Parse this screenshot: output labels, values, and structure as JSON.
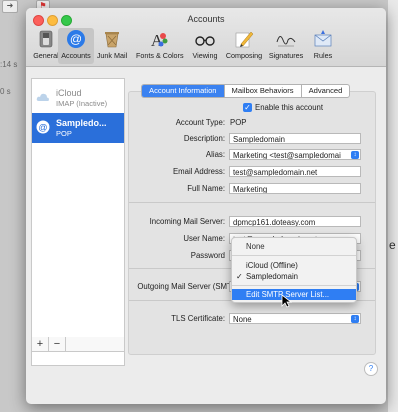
{
  "background": {
    "left_fragment_1": ":14 s",
    "left_fragment_2": "0 s",
    "right_fragment": "e"
  },
  "window": {
    "title": "Accounts"
  },
  "toolbar": {
    "items": [
      {
        "label": "General",
        "icon": "switch-icon"
      },
      {
        "label": "Accounts",
        "icon": "at-icon"
      },
      {
        "label": "Junk Mail",
        "icon": "trash-icon"
      },
      {
        "label": "Fonts & Colors",
        "icon": "font-palette-icon"
      },
      {
        "label": "Viewing",
        "icon": "glasses-icon"
      },
      {
        "label": "Composing",
        "icon": "pencil-icon"
      },
      {
        "label": "Signatures",
        "icon": "signature-icon"
      },
      {
        "label": "Rules",
        "icon": "envelope-icon"
      }
    ],
    "selected": "Accounts"
  },
  "accounts": {
    "items": [
      {
        "name": "iCloud",
        "sub": "IMAP (Inactive)",
        "icon": "cloud-icon"
      },
      {
        "name": "Sampledo...",
        "sub": "POP",
        "icon": "at-icon"
      }
    ],
    "add_label": "+",
    "remove_label": "−"
  },
  "tabs": {
    "items": [
      "Account Information",
      "Mailbox Behaviors",
      "Advanced"
    ],
    "active": "Account Information"
  },
  "form": {
    "enable_label": "Enable this account",
    "enabled": true,
    "account_type_label": "Account Type:",
    "account_type_value": "POP",
    "description_label": "Description:",
    "description_value": "Sampledomain",
    "alias_label": "Alias:",
    "alias_value": "Marketing <test@sampledomai",
    "email_label": "Email Address:",
    "email_value": "test@sampledomain.net",
    "fullname_label": "Full Name:",
    "fullname_value": "Marketing",
    "incoming_label": "Incoming Mail Server:",
    "incoming_value": "dpmcp161.doteasy.com",
    "username_label": "User Name:",
    "username_value": "test@sampledomain.net",
    "password_label": "Password",
    "outgoing_label": "Outgoing Mail Server (SMTP",
    "tls_label": "TLS Certificate:",
    "tls_value": "None"
  },
  "dropdown_menu": {
    "items": [
      {
        "label": "None",
        "checked": false
      },
      {
        "label": "iCloud (Offline)",
        "checked": false
      },
      {
        "label": "Sampledomain",
        "checked": true
      },
      {
        "label": "Edit SMTP Server List...",
        "checked": false,
        "highlighted": true
      }
    ]
  },
  "help_label": "?",
  "colors": {
    "accent": "#2f7ef3",
    "selection": "#2a6fda"
  }
}
